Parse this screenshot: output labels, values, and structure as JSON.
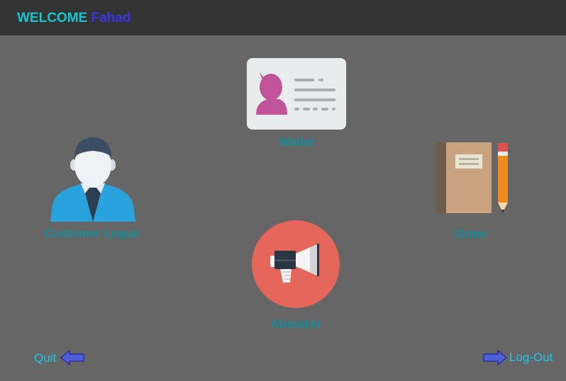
{
  "header": {
    "welcome_label": "WELCOME",
    "user_name": "Fahad"
  },
  "menu": {
    "wallet_label": "Wallet",
    "customer_label": "Customer Legue",
    "order_label": "Order",
    "aboutus_label": "AboutUs"
  },
  "footer": {
    "quit_label": "Quit",
    "logout_label": "Log-Out"
  },
  "icons": {
    "wallet": "id-card-icon",
    "customer": "person-icon",
    "order": "notebook-pencil-icon",
    "aboutus": "megaphone-icon",
    "quit": "arrow-left-icon",
    "logout": "arrow-right-icon"
  },
  "colors": {
    "background": "#666666",
    "header_bar": "#333333",
    "welcome_text": "#17c5cf",
    "user_name_text": "#3b33e6",
    "menu_label": "#138e9a",
    "nav_link": "#1fc6ec"
  }
}
